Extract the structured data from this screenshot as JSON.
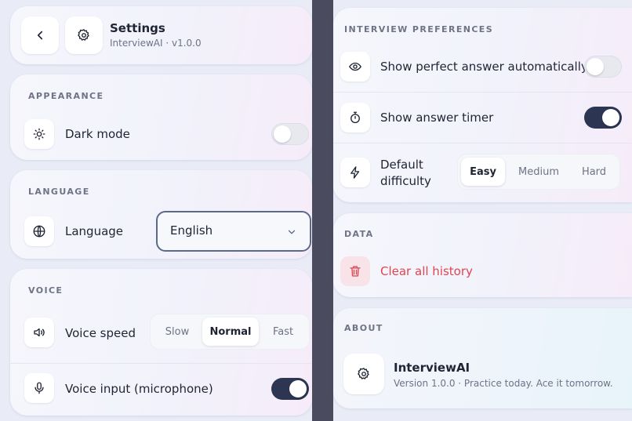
{
  "header": {
    "title": "Settings",
    "subtitle": "InterviewAI · v1.0.0"
  },
  "appearance": {
    "label": "APPEARANCE",
    "dark_mode_label": "Dark mode",
    "dark_mode_on": false
  },
  "language": {
    "label": "LANGUAGE",
    "row_label": "Language",
    "selected": "English"
  },
  "voice": {
    "label": "VOICE",
    "speed_label": "Voice speed",
    "speed_options": [
      "Slow",
      "Normal",
      "Fast"
    ],
    "speed_selected": "Normal",
    "mic_label": "Voice input (microphone)",
    "mic_on": true
  },
  "interview": {
    "label": "INTERVIEW PREFERENCES",
    "perfect_answer_label": "Show perfect answer automatically",
    "perfect_answer_on": false,
    "timer_label": "Show answer timer",
    "timer_on": true,
    "difficulty_label_line1": "Default",
    "difficulty_label_line2": "difficulty",
    "difficulty_options": [
      "Easy",
      "Medium",
      "Hard"
    ],
    "difficulty_selected": "Easy"
  },
  "data_section": {
    "label": "DATA",
    "clear_label": "Clear all history",
    "danger_color": "#e0454f"
  },
  "about": {
    "label": "ABOUT",
    "app_name": "InterviewAI",
    "tagline": "Version 1.0.0 · Practice today. Ace it tomorrow."
  },
  "colors": {
    "accent_dark": "#2c3552",
    "select_border": "#5c6a8a"
  }
}
